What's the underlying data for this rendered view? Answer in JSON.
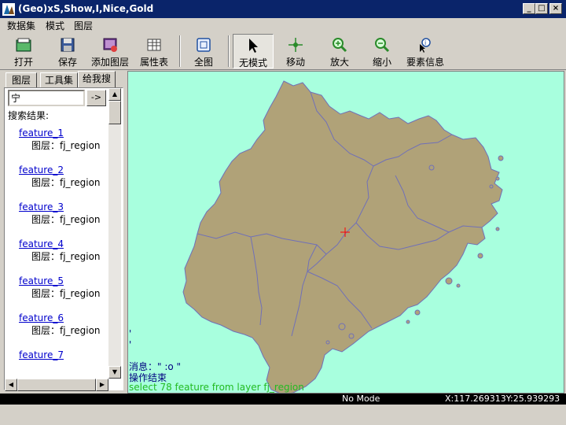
{
  "window": {
    "title": "(Geo)xS,Show,I,Nice,Gold",
    "minimize": "_",
    "maximize": "□",
    "close": "×"
  },
  "menu": [
    "数据集",
    "模式",
    "图层"
  ],
  "toolbar": {
    "open": "打开",
    "save": "保存",
    "add_layer": "添加图层",
    "attribute_table": "属性表",
    "full_extent": "全图",
    "no_mode": "无模式",
    "pan": "移动",
    "zoom_in": "放大",
    "zoom_out": "缩小",
    "feature_info": "要素信息"
  },
  "left_panel": {
    "tabs": [
      "图层",
      "工具集",
      "给我搜"
    ],
    "active_tab": 2,
    "search_value": "宁",
    "go_button": "->",
    "result_label": "搜索结果:",
    "results": [
      {
        "name": "feature_1",
        "layer": "图层：fj_region"
      },
      {
        "name": "feature_2",
        "layer": "图层：fj_region"
      },
      {
        "name": "feature_3",
        "layer": "图层：fj_region"
      },
      {
        "name": "feature_4",
        "layer": "图层：fj_region"
      },
      {
        "name": "feature_5",
        "layer": "图层：fj_region"
      },
      {
        "name": "feature_6",
        "layer": "图层：fj_region"
      },
      {
        "name": "feature_7",
        "layer": ""
      }
    ]
  },
  "map": {
    "background": "#a8ffde",
    "land_color": "#b0a278",
    "boundary_color": "#7070b8",
    "marker_color": "#ff0000",
    "messages": [
      {
        "text": "'",
        "color": "#000080"
      },
      {
        "text": "'",
        "color": "#000080"
      },
      {
        "text": "消息：\" :o \"",
        "color": "#000080"
      },
      {
        "text": "操作结束",
        "color": "#000080"
      },
      {
        "text": "select 78 feature from layer fj_region",
        "color": "#22bb22"
      }
    ]
  },
  "status": {
    "mode": "No Mode",
    "coords": "X:117.269313Y:25.939293"
  }
}
